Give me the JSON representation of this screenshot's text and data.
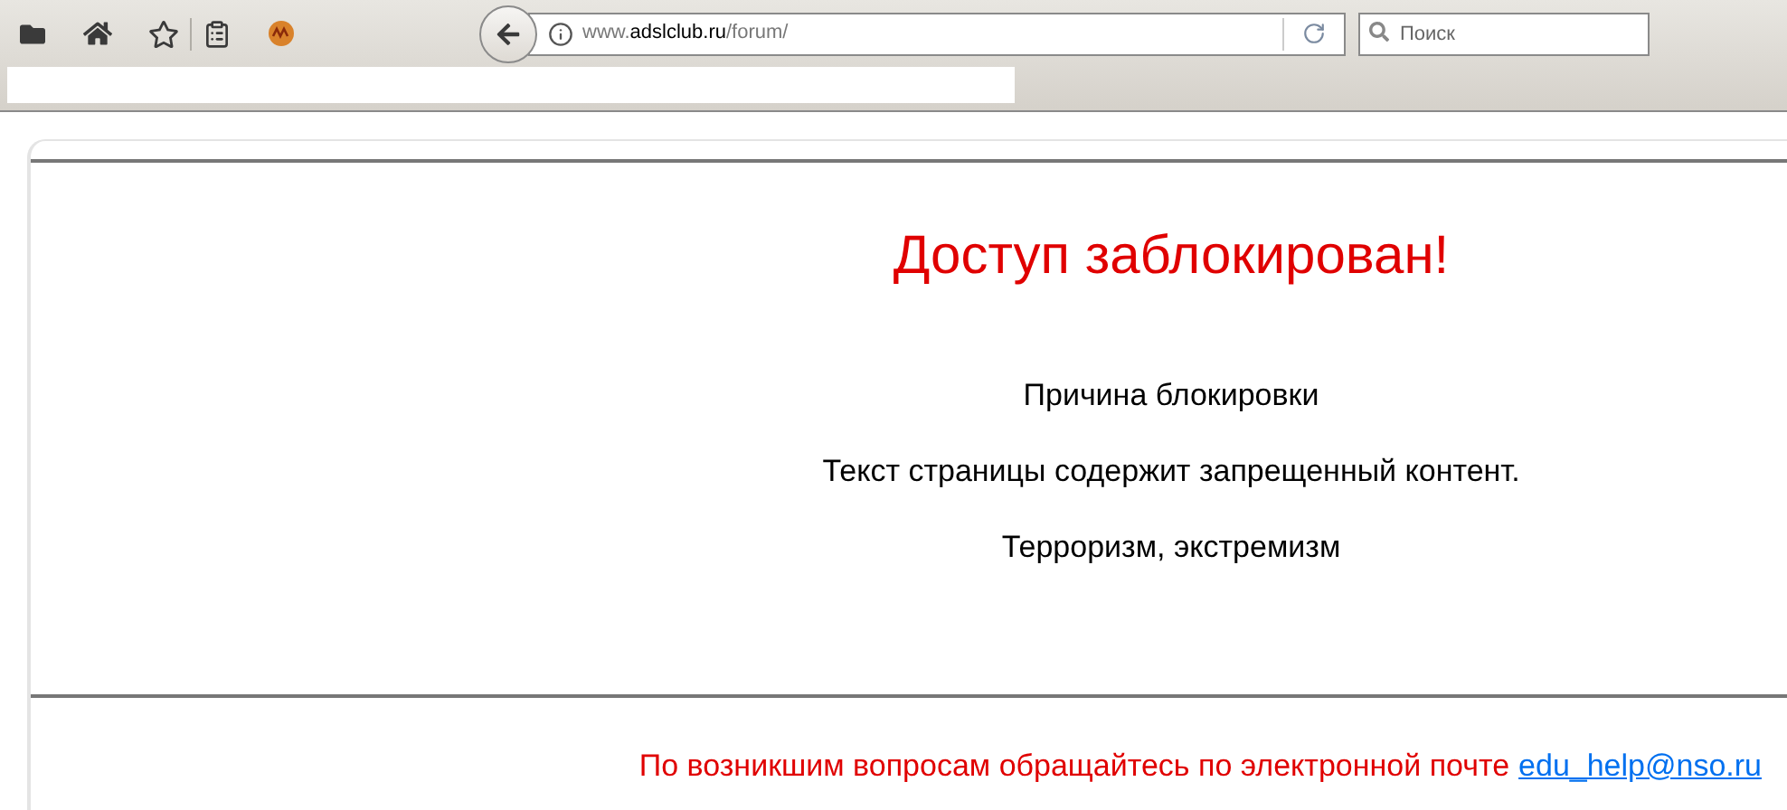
{
  "toolbar": {
    "url": "www.**adslclub.ru**/forum/",
    "search": {
      "placeholder": "Поиск"
    }
  },
  "page": {
    "title": "Доступ заблокирован!",
    "lines": [
      "Причина блокировки",
      "Текст страницы содержит запрещенный контент.",
      "Терроризм, экстремизм"
    ],
    "footer": {
      "text": "По возникшим вопросам обращайтесь по электронной почте",
      "email": "edu_help@nso.ru"
    }
  }
}
